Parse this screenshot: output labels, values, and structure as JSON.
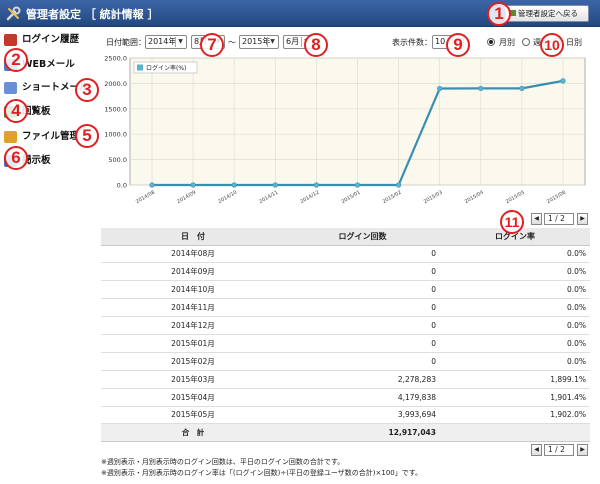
{
  "header": {
    "title": "管理者設定 ［ 統計情報 ］",
    "back_button": "管理者設定へ戻る"
  },
  "sidebar": {
    "items": [
      {
        "label": "ログイン履歴",
        "icon": "login-history-icon",
        "color": "#c0392b"
      },
      {
        "label": "WEBメール",
        "icon": "webmail-icon",
        "color": "#4a78c2"
      },
      {
        "label": "ショートメール",
        "icon": "short-mail-icon",
        "color": "#6b8fd6"
      },
      {
        "label": "回覧板",
        "icon": "circular-board-icon",
        "color": "#3d8a3d"
      },
      {
        "label": "ファイル管理",
        "icon": "folder-icon",
        "color": "#e0a12a"
      },
      {
        "label": "掲示板",
        "icon": "bulletin-board-icon",
        "color": "#3b6fb5"
      }
    ]
  },
  "filters": {
    "range_label": "日付範囲：",
    "from_year": "2014年",
    "from_month": "8月",
    "tilde": "～",
    "to_year": "2015年",
    "to_month": "6月",
    "count_label": "表示件数：",
    "count_value": "10",
    "period_options": [
      "月別",
      "週別",
      "日別"
    ],
    "period_selected": "月別"
  },
  "callouts": [
    "1",
    "2",
    "3",
    "4",
    "5",
    "6",
    "7",
    "8",
    "9",
    "10",
    "11"
  ],
  "chart_data": {
    "type": "line",
    "x": [
      "2014/08",
      "2014/09",
      "2014/10",
      "2014/11",
      "2014/12",
      "2015/01",
      "2015/02",
      "2015/03",
      "2015/04",
      "2015/05",
      "2015/06"
    ],
    "series": [
      {
        "name": "ログイン率(%)",
        "values": [
          0,
          0,
          0,
          0,
          0,
          0,
          0,
          1899.1,
          1901.4,
          1902.0,
          2050
        ],
        "color": "#5ab4d0"
      }
    ],
    "ylim": [
      0,
      2500
    ],
    "yticks": [
      "0.0",
      "500.0",
      "1000.0",
      "1500.0",
      "2000.0",
      "2500.0"
    ],
    "grid": true,
    "legend": "top-left"
  },
  "pager": {
    "current": "1 / 2",
    "prev": "◀",
    "next": "▶"
  },
  "table": {
    "headers": [
      "日　付",
      "ログイン回数",
      "ログイン率"
    ],
    "rows": [
      [
        "2014年08月",
        "0",
        "0.0%"
      ],
      [
        "2014年09月",
        "0",
        "0.0%"
      ],
      [
        "2014年10月",
        "0",
        "0.0%"
      ],
      [
        "2014年11月",
        "0",
        "0.0%"
      ],
      [
        "2014年12月",
        "0",
        "0.0%"
      ],
      [
        "2015年01月",
        "0",
        "0.0%"
      ],
      [
        "2015年02月",
        "0",
        "0.0%"
      ],
      [
        "2015年03月",
        "2,278,283",
        "1,899.1%"
      ],
      [
        "2015年04月",
        "4,179,838",
        "1,901.4%"
      ],
      [
        "2015年05月",
        "3,993,694",
        "1,902.0%"
      ]
    ],
    "total_label": "合　計",
    "total_value": "12,917,043"
  },
  "notes": [
    "※週別表示・月別表示時のログイン回数は、平日のログイン回数の合計です。",
    "※週別表示・月別表示時のログイン率は「(ログイン回数)÷(平日の登録ユーザ数の合計)×100」です。"
  ]
}
